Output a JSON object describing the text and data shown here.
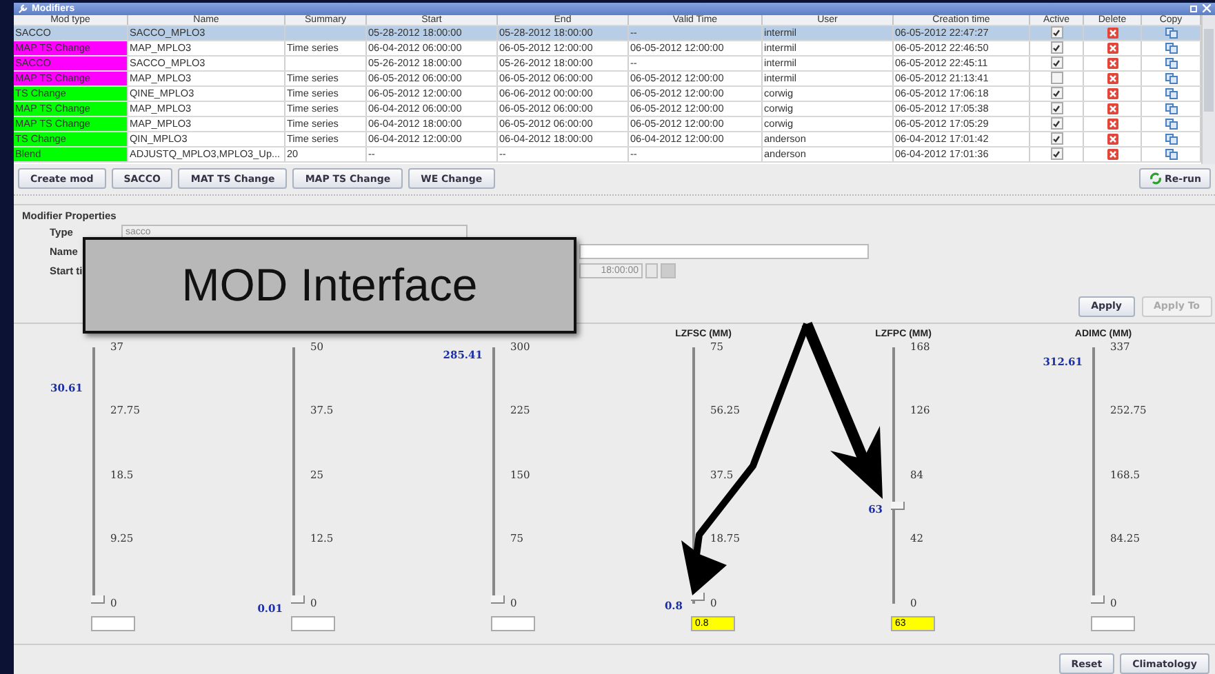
{
  "window": {
    "title": "Modifiers"
  },
  "table": {
    "columns": [
      "Mod type",
      "Name",
      "Summary",
      "Start",
      "End",
      "Valid Time",
      "User",
      "Creation time",
      "Active",
      "Delete",
      "Copy"
    ],
    "rows": [
      {
        "mod_type": "SACCO",
        "name": "SACCO_MPLO3",
        "start": "05-28-2012 18:00:00",
        "end": "05-28-2012 18:00:00",
        "valid_time": "--",
        "user": "intermil",
        "created": "06-05-2012 22:47:27",
        "active": true,
        "selected": true
      },
      {
        "mod_type": "MAP TS Change",
        "color": "#ff00ff",
        "name": "MAP_MPLO3",
        "summary": "Time series",
        "start": "06-04-2012 06:00:00",
        "end": "06-05-2012 12:00:00",
        "valid_time": "06-05-2012 12:00:00",
        "user": "intermil",
        "created": "06-05-2012 22:46:50",
        "active": true,
        "selected": false
      },
      {
        "mod_type": "SACCO",
        "color": "#ff00ff",
        "name": "SACCO_MPLO3",
        "start": "05-26-2012 18:00:00",
        "end": "05-26-2012 18:00:00",
        "valid_time": "--",
        "user": "intermil",
        "created": "06-05-2012 22:45:11",
        "active": true,
        "selected": false
      },
      {
        "mod_type": "MAP TS Change",
        "color": "#ff00ff",
        "name": "MAP_MPLO3",
        "summary": "Time series",
        "start": "06-05-2012 06:00:00",
        "end": "06-05-2012 06:00:00",
        "valid_time": "06-05-2012 12:00:00",
        "user": "intermil",
        "created": "06-05-2012 21:13:41",
        "active": false,
        "selected": false
      },
      {
        "mod_type": "TS Change",
        "color": "#00ff00",
        "name": "QINE_MPLO3",
        "summary": "Time series",
        "start": "06-05-2012 12:00:00",
        "end": "06-06-2012 00:00:00",
        "valid_time": "06-05-2012 12:00:00",
        "user": "corwig",
        "created": "06-05-2012 17:06:18",
        "active": true,
        "selected": false
      },
      {
        "mod_type": "MAP TS Change",
        "color": "#00ff00",
        "name": "MAP_MPLO3",
        "summary": "Time series",
        "start": "06-04-2012 06:00:00",
        "end": "06-05-2012 06:00:00",
        "valid_time": "06-05-2012 12:00:00",
        "user": "corwig",
        "created": "06-05-2012 17:05:38",
        "active": true,
        "selected": false
      },
      {
        "mod_type": "MAP TS Change",
        "color": "#00ff00",
        "name": "MAP_MPLO3",
        "summary": "Time series",
        "start": "06-04-2012 18:00:00",
        "end": "06-05-2012 06:00:00",
        "valid_time": "06-05-2012 12:00:00",
        "user": "corwig",
        "created": "06-05-2012 17:05:29",
        "active": true,
        "selected": false
      },
      {
        "mod_type": "TS Change",
        "color": "#00ff00",
        "name": "QIN_MPLO3",
        "summary": "Time series",
        "start": "06-04-2012 12:00:00",
        "end": "06-04-2012 18:00:00",
        "valid_time": "06-04-2012 12:00:00",
        "user": "anderson",
        "created": "06-04-2012 17:01:42",
        "active": true,
        "selected": false
      },
      {
        "mod_type": "Blend",
        "color": "#00ff00",
        "name": "ADJUSTQ_MPLO3,MPLO3_Up...",
        "summary": "20",
        "start": "--",
        "end": "--",
        "valid_time": "--",
        "user": "anderson",
        "created": "06-04-2012 17:01:36",
        "active": true,
        "selected": false
      }
    ]
  },
  "toolbar": {
    "buttons": [
      "Create mod",
      "SACCO",
      "MAT TS Change",
      "MAP TS Change",
      "WE Change"
    ],
    "rerun": "Re-run"
  },
  "properties": {
    "title": "Modifier Properties",
    "type_label": "Type",
    "type_value": "sacco",
    "name_label": "Name",
    "start_label": "Start ti",
    "start_value": "18:00:00"
  },
  "apply_buttons": [
    {
      "label": "Apply",
      "disabled": false
    },
    {
      "label": "Apply To",
      "disabled": true
    }
  ],
  "sliders": [
    {
      "ticks": [
        "37",
        "27.75",
        "18.5",
        "9.25",
        "0"
      ],
      "value": "30.61",
      "level": 0,
      "modified": false
    },
    {
      "ticks": [
        "50",
        "37.5",
        "25",
        "12.5",
        "0"
      ],
      "value": "0.01",
      "level": 0,
      "modified": false
    },
    {
      "ticks": [
        "300",
        "225",
        "150",
        "75",
        "0"
      ],
      "value": "285.41",
      "level": 0,
      "modified": false
    },
    {
      "header": "LZFSC (MM)",
      "ticks": [
        "75",
        "56.25",
        "37.5",
        "18.75",
        "0"
      ],
      "value": "0.8",
      "level": 0.01,
      "input": "0.8",
      "modified": true
    },
    {
      "header": "LZFPC (MM)",
      "ticks": [
        "168",
        "126",
        "84",
        "42",
        "0"
      ],
      "value": "63",
      "level": 0.375,
      "input": "63",
      "modified": true
    },
    {
      "header": "ADIMC (MM)",
      "ticks": [
        "337",
        "252.75",
        "168.5",
        "84.25",
        "0"
      ],
      "value": "312.61",
      "level": 0,
      "modified": false
    }
  ],
  "bottom_buttons": [
    "Reset",
    "Climatology"
  ],
  "callout": {
    "text": "MOD Interface"
  }
}
